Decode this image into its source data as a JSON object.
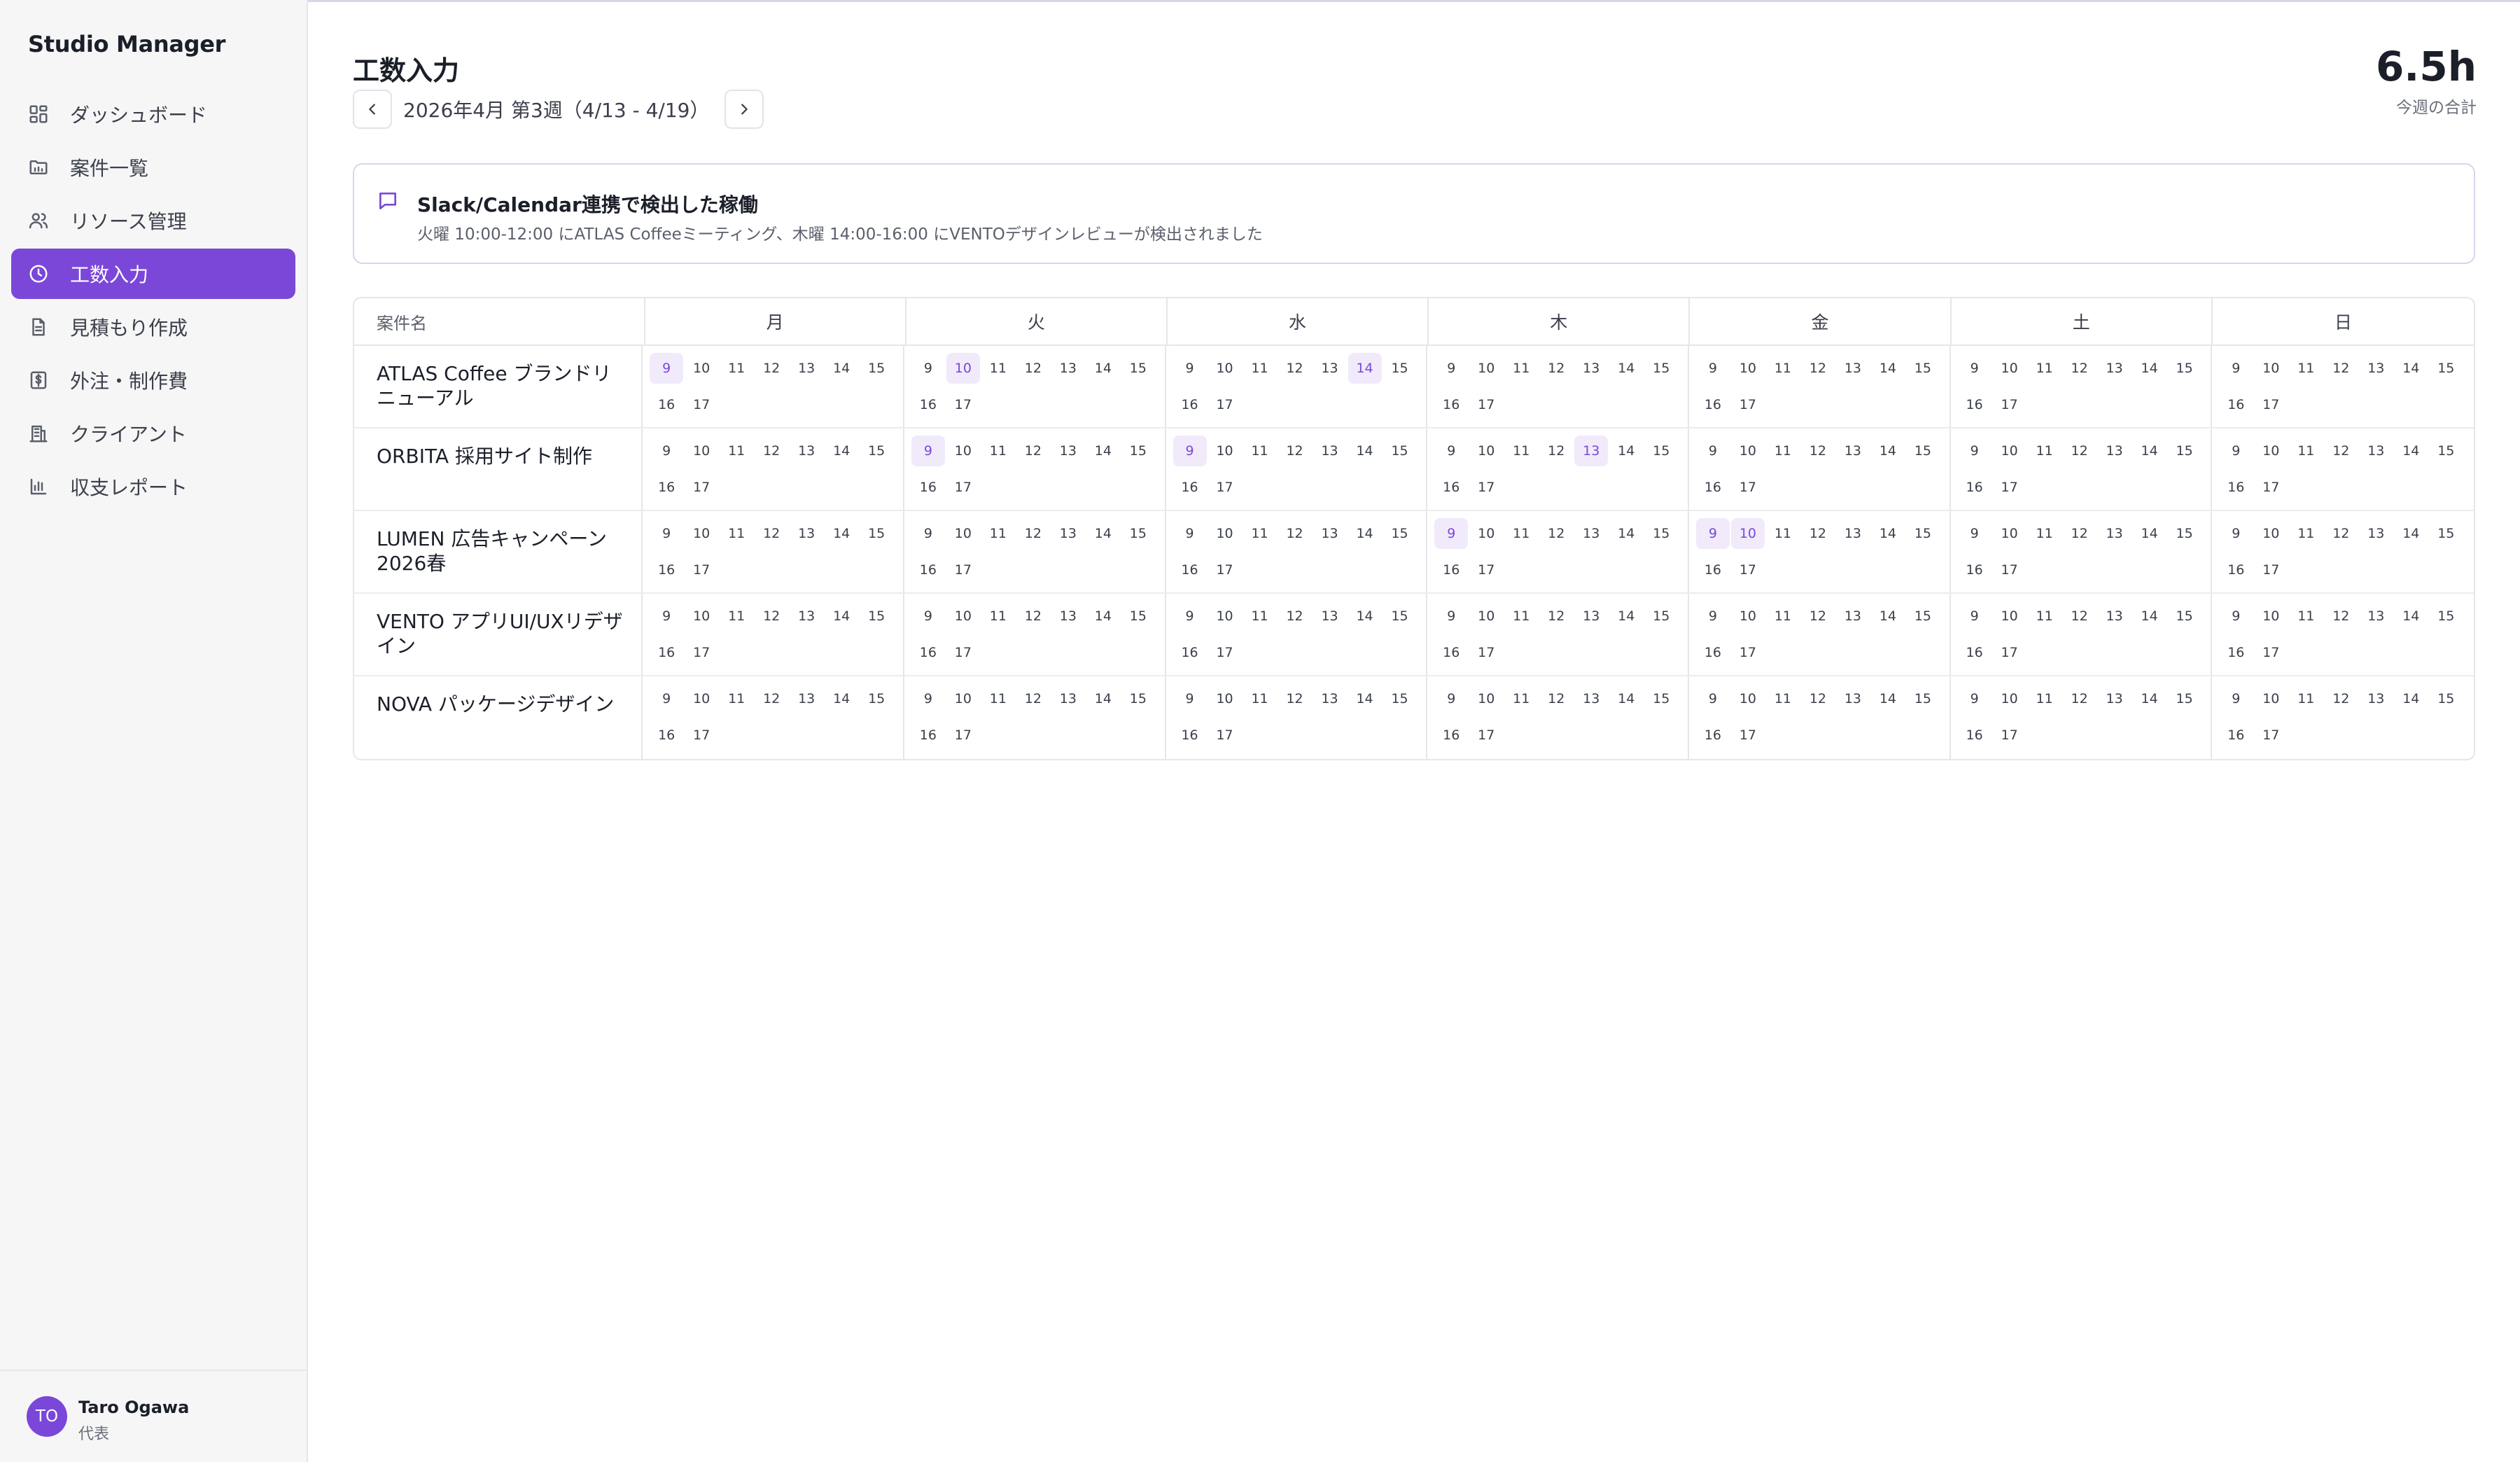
{
  "app": {
    "name": "Studio Manager"
  },
  "sidebar": {
    "items": [
      {
        "label": "ダッシュボード",
        "icon": "dashboard-icon",
        "active": false
      },
      {
        "label": "案件一覧",
        "icon": "folder-icon",
        "active": false
      },
      {
        "label": "リソース管理",
        "icon": "users-icon",
        "active": false
      },
      {
        "label": "工数入力",
        "icon": "clock-icon",
        "active": true
      },
      {
        "label": "見積もり作成",
        "icon": "document-icon",
        "active": false
      },
      {
        "label": "外注・制作費",
        "icon": "dollar-icon",
        "active": false
      },
      {
        "label": "クライアント",
        "icon": "building-icon",
        "active": false
      },
      {
        "label": "収支レポート",
        "icon": "bar-chart-icon",
        "active": false
      }
    ],
    "user": {
      "initials": "TO",
      "name": "Taro Ogawa",
      "role": "代表"
    }
  },
  "header": {
    "title": "工数入力",
    "week_label": "2026年4月 第3週（4/13 - 4/19）",
    "total_value": "6.5h",
    "total_label": "今週の合計"
  },
  "notice": {
    "icon": "message-icon",
    "title": "Slack/Calendar連携で検出した稼働",
    "detail": "火曜 10:00-12:00 にATLAS Coffeeミーティング、木曜 14:00-16:00 にVENTOデザインレビューが検出されました"
  },
  "grid": {
    "project_header": "案件名",
    "days": [
      "月",
      "火",
      "水",
      "木",
      "金",
      "土",
      "日"
    ],
    "hours": [
      "9",
      "10",
      "11",
      "12",
      "13",
      "14",
      "15",
      "16",
      "17"
    ],
    "rows": [
      {
        "project": "ATLAS Coffee ブランドリニューアル",
        "selected": [
          [
            "9"
          ],
          [
            "10"
          ],
          [
            "14"
          ],
          [],
          [],
          [],
          []
        ]
      },
      {
        "project": "ORBITA 採用サイト制作",
        "selected": [
          [],
          [
            "9"
          ],
          [
            "9"
          ],
          [
            "13"
          ],
          [],
          [],
          []
        ]
      },
      {
        "project": "LUMEN 広告キャンペーン2026春",
        "selected": [
          [],
          [],
          [],
          [
            "9"
          ],
          [
            "9",
            "10"
          ],
          [],
          []
        ]
      },
      {
        "project": "VENTO アプリUI/UXリデザイン",
        "selected": [
          [],
          [],
          [],
          [],
          [],
          [],
          []
        ]
      },
      {
        "project": "NOVA パッケージデザイン",
        "selected": [
          [],
          [],
          [],
          [],
          [],
          [],
          []
        ]
      }
    ]
  }
}
